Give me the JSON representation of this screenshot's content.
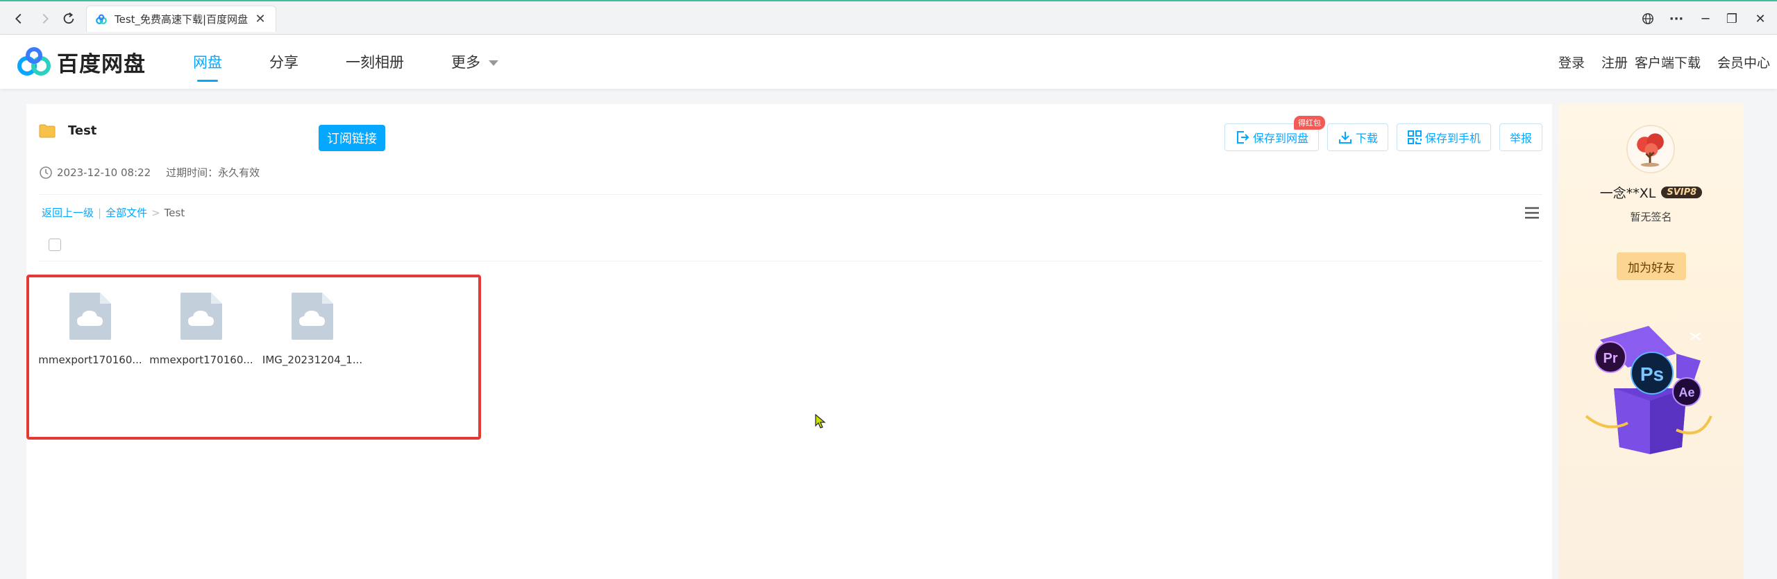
{
  "browser": {
    "tab_title": "Test_免费高速下载|百度网盘",
    "tab_close": "✕",
    "win_min": "─",
    "win_restore": "❐",
    "win_close": "✕",
    "more_glyph": "···"
  },
  "header": {
    "brand": "百度网盘",
    "nav": [
      "网盘",
      "分享",
      "一刻相册",
      "更多"
    ],
    "active_nav": "网盘",
    "right_links": [
      "登录",
      "注册",
      "客户端下载",
      "会员中心"
    ]
  },
  "share": {
    "folder_name": "Test",
    "subscribe_label": "订阅链接",
    "created": "2023-12-10 08:22",
    "expire_label": "过期时间：永久有效",
    "actions": {
      "save_cloud": "保存到网盘",
      "save_badge": "得红包",
      "download": "下载",
      "save_phone": "保存到手机",
      "report": "举报"
    },
    "breadcrumb": {
      "back": "返回上一级",
      "all_files": "全部文件",
      "sep": "|",
      "arrow": ">",
      "current": "Test"
    },
    "files": [
      {
        "name": "mmexport170160..."
      },
      {
        "name": "mmexport170160..."
      },
      {
        "name": "IMG_20231204_1..."
      }
    ]
  },
  "profile": {
    "username": "一念**XL",
    "vip_badge": "SVIP8",
    "signature": "暂无签名",
    "add_friend": "加为好友",
    "promo_icons": [
      "Pr",
      "Ps",
      "Ae"
    ]
  },
  "colors": {
    "accent": "#06a7ff",
    "selection": "#e53935",
    "badge": "#f25a55"
  }
}
